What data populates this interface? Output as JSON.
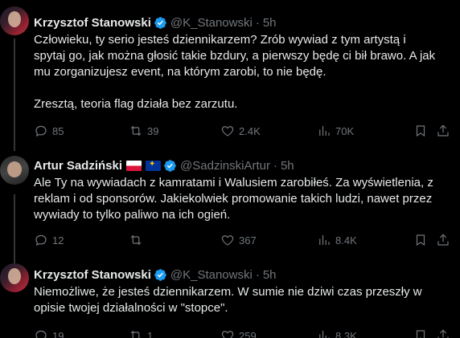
{
  "tweets": [
    {
      "name": "Krzysztof Stanowski",
      "handle": "@K_Stanowski",
      "dot": "·",
      "time": "5h",
      "lines": [
        "Człowieku, ty serio jesteś dziennikarzem? Zrób wywiad z tym artystą i",
        "spytaj go, jak można głosić takie bzdury, a pierwszy będę ci bił brawo. A jak",
        "mu zorganizujesz event, na którym zarobi, to nie będę.",
        "",
        "Zresztą, teoria flag działa bez zarzutu."
      ],
      "replies": "85",
      "reposts": "39",
      "likes": "2.4K",
      "views": "70K"
    },
    {
      "name": "Artur Sadziński",
      "handle": "@SadzinskiArtur",
      "dot": "·",
      "time": "5h",
      "lines": [
        "Ale Ty na wywiadach z kamratami  i Walusiem zarobiłeś. Za wyświetlenia, z",
        "reklam i od sponsorów. Jakiekolwiek promowanie takich ludzi, nawet przez",
        "wywiady to tylko paliwo na ich ogień."
      ],
      "replies": "12",
      "reposts": "",
      "likes": "367",
      "views": "8.4K"
    },
    {
      "name": "Krzysztof Stanowski",
      "handle": "@K_Stanowski",
      "dot": "·",
      "time": "5h",
      "lines": [
        "Niemożliwe, że jesteś dziennikarzem. W sumie nie dziwi czas przeszły w",
        "opisie twojej działalności w \"stopce\"."
      ],
      "replies": "19",
      "reposts": "1",
      "likes": "259",
      "views": "8.3K"
    }
  ],
  "colors": {
    "bg": "#000000",
    "text": "#e7e9ea",
    "muted": "#71767b",
    "verified": "#1d9bf0"
  },
  "icons": [
    "verified-badge-icon",
    "reply-icon",
    "repost-icon",
    "like-icon",
    "views-icon",
    "bookmark-icon",
    "share-icon",
    "poland-flag-icon",
    "eu-flag-icon"
  ]
}
